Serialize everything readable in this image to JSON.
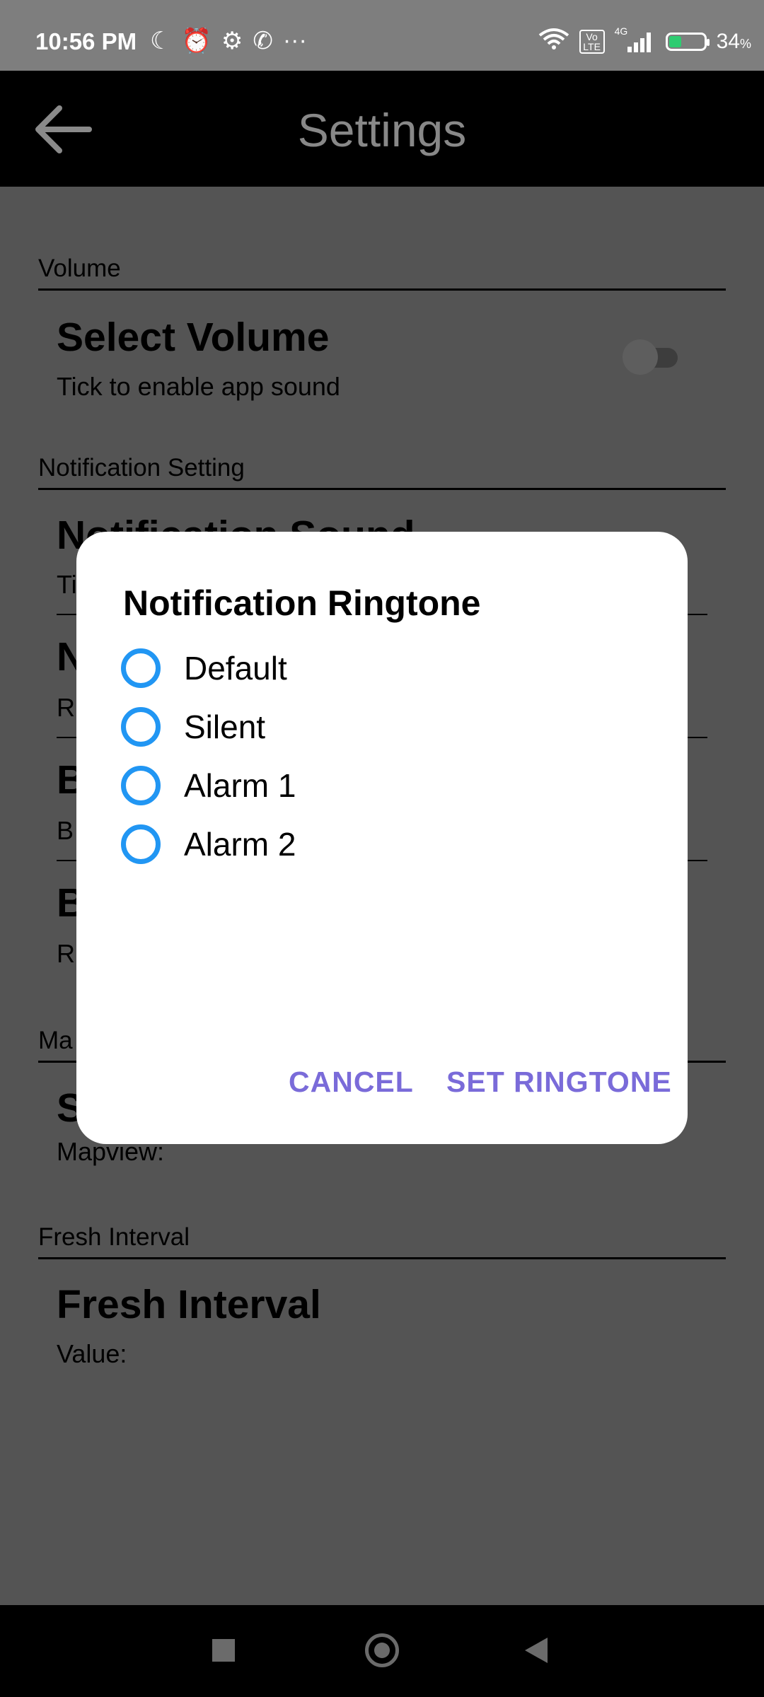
{
  "status_bar": {
    "time": "10:56 PM",
    "left_icons": [
      "moon-icon",
      "alarm-icon",
      "gear-icon",
      "whatsapp-icon",
      "more-dots-icon"
    ],
    "right_icons": [
      "wifi-icon",
      "volte-icon",
      "signal-4g-icon",
      "battery-icon"
    ],
    "network_label": "4G",
    "volte_label": "Vo LTE",
    "battery_percent": "34",
    "battery_percent_sign": "%"
  },
  "app_bar": {
    "title": "Settings",
    "back_icon": "arrow-left-icon"
  },
  "settings": {
    "volume_section": {
      "header": "Volume",
      "title": "Select Volume",
      "subtitle": "Tick to enable app sound",
      "toggle_on": false
    },
    "notification_section": {
      "header": "Notification Setting",
      "partial_title": "Notification Sound",
      "partial_sub": "Ti",
      "row2_title": "N",
      "row2_sub": "R",
      "row3_title": "B",
      "row3_sub": "B",
      "row4_title": "B",
      "row4_sub": "R"
    },
    "map_section": {
      "header_partial": "Ma",
      "title_partial": "S",
      "subtitle": "Mapview:"
    },
    "fresh_section": {
      "header": "Fresh Interval",
      "title": "Fresh Interval",
      "subtitle": "Value:"
    }
  },
  "dialog": {
    "title": "Notification Ringtone",
    "options": [
      {
        "label": "Default",
        "selected": false
      },
      {
        "label": "Silent",
        "selected": false
      },
      {
        "label": "Alarm 1",
        "selected": false
      },
      {
        "label": "Alarm 2",
        "selected": false
      }
    ],
    "cancel_label": "CANCEL",
    "confirm_label": "SET RINGTONE",
    "accent_color": "#2196f3",
    "button_color": "#7a6bd9"
  },
  "nav_bar": {
    "buttons": [
      "recents-square-icon",
      "home-circle-icon",
      "back-triangle-icon"
    ]
  }
}
